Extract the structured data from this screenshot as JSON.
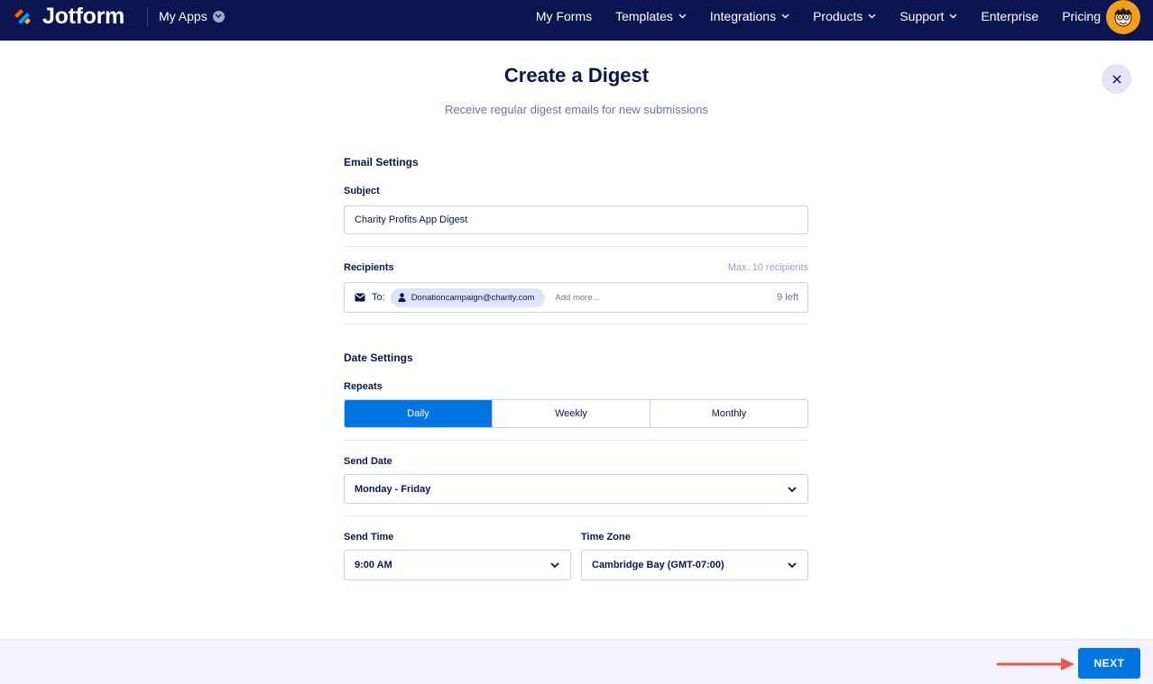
{
  "topbar": {
    "brand": "Jotform",
    "my_apps": "My Apps",
    "nav": [
      {
        "label": "My Forms",
        "has_dropdown": false
      },
      {
        "label": "Templates",
        "has_dropdown": true
      },
      {
        "label": "Integrations",
        "has_dropdown": true
      },
      {
        "label": "Products",
        "has_dropdown": true
      },
      {
        "label": "Support",
        "has_dropdown": true
      },
      {
        "label": "Enterprise",
        "has_dropdown": false
      },
      {
        "label": "Pricing",
        "has_dropdown": false
      }
    ],
    "chevron": "⌄"
  },
  "dialog": {
    "title": "Create a Digest",
    "subtitle": "Receive regular digest emails for new submissions",
    "close_glyph": "×"
  },
  "email_settings": {
    "section_title": "Email Settings",
    "subject_label": "Subject",
    "subject_value": "Charity Profits App Digest",
    "recipients_label": "Recipients",
    "recipients_hint": "Max. 10 recipients",
    "to_label": "To:",
    "recipient_chip": "Donationcampaign@charity.com",
    "add_more_placeholder": "Add more...",
    "remaining": "9 left"
  },
  "date_settings": {
    "section_title": "Date Settings",
    "repeats_label": "Repeats",
    "repeat_options": [
      "Daily",
      "Weekly",
      "Monthly"
    ],
    "repeat_selected": "Daily",
    "send_date_label": "Send Date",
    "send_date_value": "Monday - Friday",
    "send_time_label": "Send Time",
    "send_time_value": "9:00 AM",
    "time_zone_label": "Time Zone",
    "time_zone_value": "Cambridge Bay (GMT-07:00)"
  },
  "footer": {
    "next_label": "NEXT"
  },
  "colors": {
    "navy": "#0a1551",
    "primary": "#0075e3",
    "annotation_arrow": "#e8574a"
  }
}
